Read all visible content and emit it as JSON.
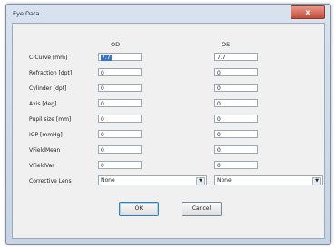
{
  "window": {
    "title": "Eye Data",
    "close_glyph": "x"
  },
  "columns": {
    "od": "OD",
    "os": "OS"
  },
  "rows": [
    {
      "label": "C-Curve [mm]",
      "od": "7.7",
      "os": "7.7"
    },
    {
      "label": "Refraction [dpt]",
      "od": "0",
      "os": "0"
    },
    {
      "label": "Cylinder [dpt]",
      "od": "0",
      "os": "0"
    },
    {
      "label": "Axis [deg]",
      "od": "0",
      "os": "0"
    },
    {
      "label": "Pupil size [mm]",
      "od": "0",
      "os": "0"
    },
    {
      "label": "IOP [mmHg]",
      "od": "0",
      "os": "0"
    },
    {
      "label": "VFieldMean",
      "od": "0",
      "os": "0"
    },
    {
      "label": "VFieldVar",
      "od": "0",
      "os": "0"
    }
  ],
  "corrective_lens": {
    "label": "Corrective Lens",
    "od": "None",
    "os": "None"
  },
  "buttons": {
    "ok": "OK",
    "cancel": "Cancel"
  }
}
